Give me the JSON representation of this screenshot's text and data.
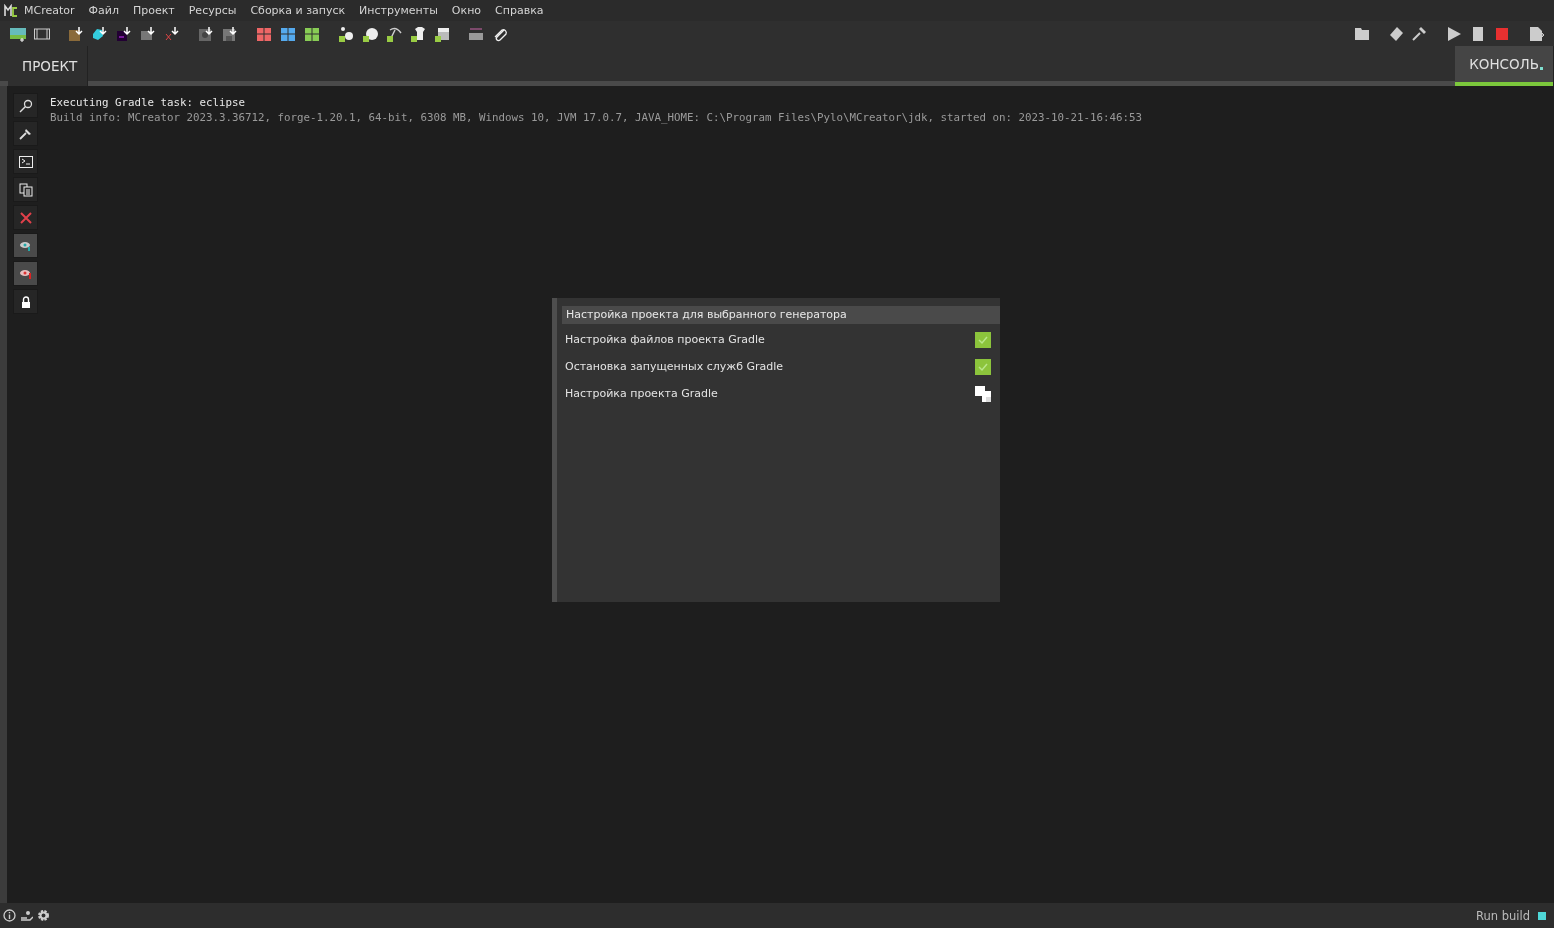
{
  "menu_bar": {
    "app": "MCreator",
    "items": [
      "Файл",
      "Проект",
      "Ресурсы",
      "Сборка и запуск",
      "Инструменты",
      "Окно",
      "Справка"
    ]
  },
  "tabs": [
    {
      "label": "ПРОЕКТ",
      "selected": false
    },
    {
      "label": "КОНСОЛЬ",
      "selected": true
    }
  ],
  "side_tools": [
    {
      "kind": "search",
      "pressed": false
    },
    {
      "kind": "hammer",
      "pressed": false
    },
    {
      "kind": "terminal",
      "pressed": false
    },
    {
      "kind": "copy",
      "pressed": false
    },
    {
      "kind": "clear",
      "pressed": false
    },
    {
      "kind": "eye",
      "pressed": true
    },
    {
      "kind": "eye-error",
      "pressed": true
    },
    {
      "kind": "lock",
      "pressed": false
    }
  ],
  "console": [
    {
      "kind": "command",
      "text": "Executing Gradle task: eclipse"
    },
    {
      "kind": "info",
      "text": "Build info: MCreator 2023.3.36712, forge-1.20.1, 64-bit, 6308 MB, Windows 10, JVM 17.0.7, JAVA_HOME: C:\\Program Files\\Pylo\\MCreator\\jdk, started on: 2023-10-21-16:46:53"
    }
  ],
  "progress_dialog": {
    "title": "Настройка проекта для выбранного генератора",
    "tasks": [
      {
        "label": "Настройка файлов проекта Gradle",
        "done": true
      },
      {
        "label": "Остановка запущенных служб Gradle",
        "done": true
      },
      {
        "label": "Настройка проекта Gradle",
        "done": false
      }
    ]
  },
  "status_bar": {
    "text": "Run build"
  }
}
